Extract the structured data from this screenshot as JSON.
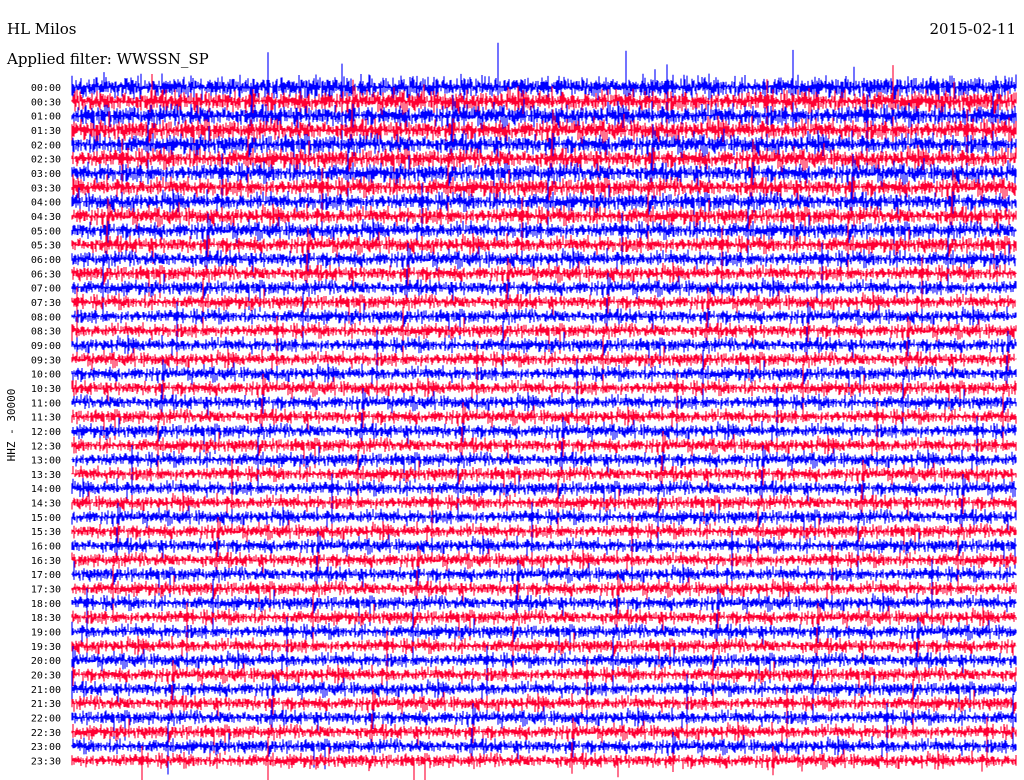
{
  "header": {
    "station": "HL Milos",
    "date": "2015-02-11",
    "filter_label": "Applied filter: WWSSN_SP"
  },
  "chart_data": {
    "type": "line",
    "chart_kind": "helicorder",
    "ylabel": "HHZ - 30000",
    "row_labels": [
      "00:00",
      "00:30",
      "01:00",
      "01:30",
      "02:00",
      "02:30",
      "03:00",
      "03:30",
      "04:00",
      "04:30",
      "05:00",
      "05:30",
      "06:00",
      "06:30",
      "07:00",
      "07:30",
      "08:00",
      "08:30",
      "09:00",
      "09:30",
      "10:00",
      "10:30",
      "11:00",
      "11:30",
      "12:00",
      "12:30",
      "13:00",
      "13:30",
      "14:00",
      "14:30",
      "15:00",
      "15:30",
      "16:00",
      "16:30",
      "17:00",
      "17:30",
      "18:00",
      "18:30",
      "19:00",
      "19:30",
      "20:00",
      "20:30",
      "21:00",
      "21:30",
      "22:00",
      "22:30",
      "23:00",
      "23:30"
    ],
    "colors": {
      "odd_rows": "#0000ff",
      "even_rows": "#ff0033"
    },
    "grid": false
  }
}
